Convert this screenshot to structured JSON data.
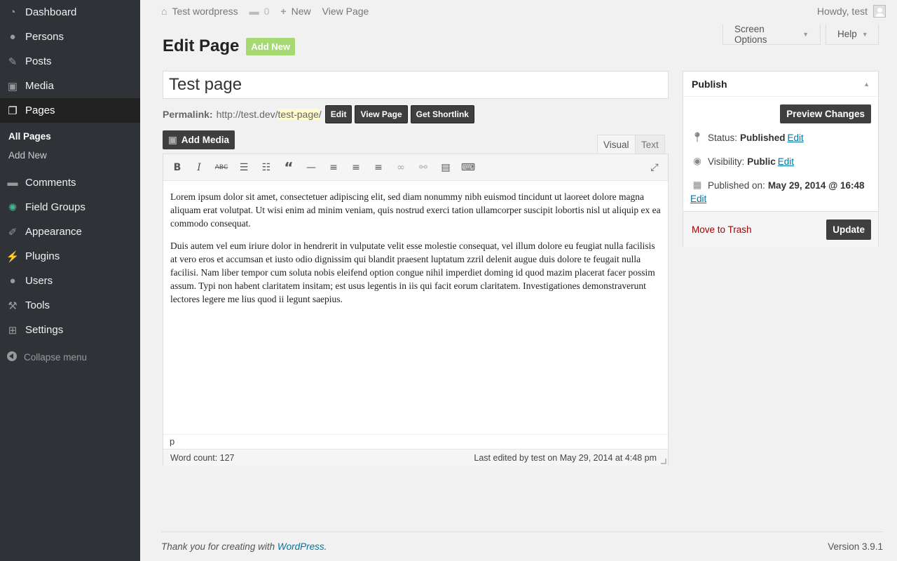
{
  "sidebar": {
    "items": [
      {
        "label": "Dashboard",
        "icon": "dashboard-icon"
      },
      {
        "label": "Persons",
        "icon": "persons-icon"
      },
      {
        "label": "Posts",
        "icon": "pin-icon"
      },
      {
        "label": "Media",
        "icon": "media-icon"
      },
      {
        "label": "Pages",
        "icon": "pages-icon"
      },
      {
        "label": "Comments",
        "icon": "comment-icon"
      },
      {
        "label": "Field Groups",
        "icon": "field-groups-icon"
      },
      {
        "label": "Appearance",
        "icon": "brush-icon"
      },
      {
        "label": "Plugins",
        "icon": "plug-icon"
      },
      {
        "label": "Users",
        "icon": "user-icon"
      },
      {
        "label": "Tools",
        "icon": "wrench-icon"
      },
      {
        "label": "Settings",
        "icon": "settings-icon"
      }
    ],
    "submenu": [
      "All Pages",
      "Add New"
    ],
    "collapse": "Collapse menu"
  },
  "adminbar": {
    "site": "Test wordpress",
    "comments_count": "0",
    "new": "New",
    "view_page": "View Page",
    "howdy": "Howdy, test"
  },
  "tabs": {
    "screen_options": "Screen Options",
    "help": "Help"
  },
  "heading": {
    "title": "Edit Page",
    "add_new": "Add New"
  },
  "post": {
    "title": "Test page"
  },
  "permalink": {
    "label": "Permalink:",
    "base": "http://test.dev/",
    "slug": "test-page",
    "trail": "/",
    "edit": "Edit",
    "view": "View Page",
    "shortlink": "Get Shortlink"
  },
  "editor": {
    "add_media": "Add Media",
    "tab_visual": "Visual",
    "tab_text": "Text",
    "paragraphs": [
      "Lorem ipsum dolor sit amet, consectetuer adipiscing elit, sed diam nonummy nibh euismod tincidunt ut laoreet dolore magna aliquam erat volutpat. Ut wisi enim ad minim veniam, quis nostrud exerci tation ullamcorper suscipit lobortis nisl ut aliquip ex ea commodo consequat.",
      "Duis autem vel eum iriure dolor in hendrerit in vulputate velit esse molestie consequat, vel illum dolore eu feugiat nulla facilisis at vero eros et accumsan et iusto odio dignissim qui blandit praesent luptatum zzril delenit augue duis dolore te feugait nulla facilisi. Nam liber tempor cum soluta nobis eleifend option congue nihil imperdiet doming id quod mazim placerat facer possim assum. Typi non habent claritatem insitam; est usus legentis in iis qui facit eorum claritatem. Investigationes demonstraverunt lectores legere me lius quod ii legunt saepius."
    ],
    "path": "p",
    "word_count": "Word count: 127",
    "last_edited": "Last edited by test on May 29, 2014 at 4:48 pm"
  },
  "publish": {
    "title": "Publish",
    "preview": "Preview Changes",
    "status_label": "Status:",
    "status_value": "Published",
    "visibility_label": "Visibility:",
    "visibility_value": "Public",
    "published_label": "Published on:",
    "published_value": "May 29, 2014 @ 16:48",
    "edit": "Edit",
    "trash": "Move to Trash",
    "update": "Update"
  },
  "footer": {
    "thanks": "Thank you for creating with ",
    "wp": "WordPress",
    "dot": ".",
    "version": "Version 3.9.1"
  },
  "colors": {
    "sidebar_bg": "#2f3338",
    "accent_green": "#a6d971",
    "link": "#0074a2",
    "trash": "#aa0000"
  }
}
